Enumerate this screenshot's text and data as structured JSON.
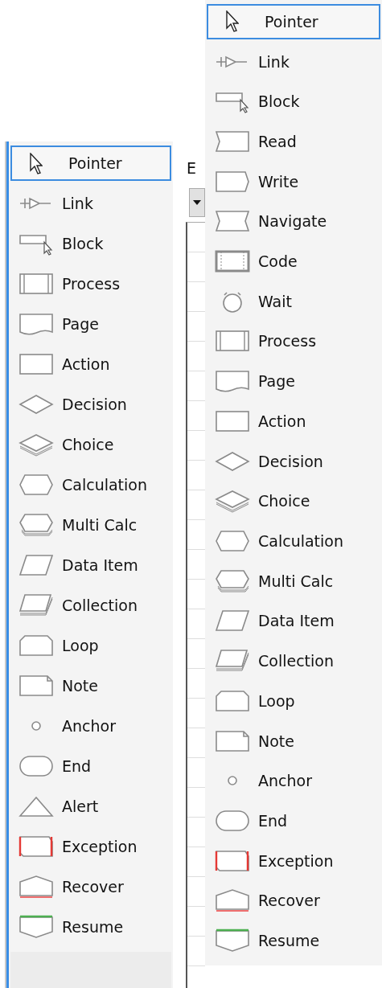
{
  "left_toolbox": {
    "items": [
      {
        "label": "Pointer",
        "kind": "pointer",
        "selected": true
      },
      {
        "label": "Link",
        "kind": "link",
        "selected": false
      },
      {
        "label": "Block",
        "kind": "block",
        "selected": false
      },
      {
        "label": "Process",
        "kind": "process",
        "selected": false
      },
      {
        "label": "Page",
        "kind": "page",
        "selected": false
      },
      {
        "label": "Action",
        "kind": "action",
        "selected": false
      },
      {
        "label": "Decision",
        "kind": "decision",
        "selected": false
      },
      {
        "label": "Choice",
        "kind": "choice",
        "selected": false
      },
      {
        "label": "Calculation",
        "kind": "calculation",
        "selected": false
      },
      {
        "label": "Multi Calc",
        "kind": "multicalc",
        "selected": false
      },
      {
        "label": "Data Item",
        "kind": "dataitem",
        "selected": false
      },
      {
        "label": "Collection",
        "kind": "collection",
        "selected": false
      },
      {
        "label": "Loop",
        "kind": "loop",
        "selected": false
      },
      {
        "label": "Note",
        "kind": "note",
        "selected": false
      },
      {
        "label": "Anchor",
        "kind": "anchor",
        "selected": false
      },
      {
        "label": "End",
        "kind": "end",
        "selected": false
      },
      {
        "label": "Alert",
        "kind": "alert",
        "selected": false
      },
      {
        "label": "Exception",
        "kind": "exception",
        "selected": false
      },
      {
        "label": "Recover",
        "kind": "recover",
        "selected": false
      },
      {
        "label": "Resume",
        "kind": "resume",
        "selected": false
      }
    ]
  },
  "middle_fragment": {
    "label": "E"
  },
  "right_toolbox": {
    "items": [
      {
        "label": "Pointer",
        "kind": "pointer",
        "selected": true
      },
      {
        "label": "Link",
        "kind": "link",
        "selected": false
      },
      {
        "label": "Block",
        "kind": "block",
        "selected": false
      },
      {
        "label": "Read",
        "kind": "read",
        "selected": false
      },
      {
        "label": "Write",
        "kind": "write",
        "selected": false
      },
      {
        "label": "Navigate",
        "kind": "navigate",
        "selected": false
      },
      {
        "label": "Code",
        "kind": "code",
        "selected": false
      },
      {
        "label": "Wait",
        "kind": "wait",
        "selected": false
      },
      {
        "label": "Process",
        "kind": "process",
        "selected": false
      },
      {
        "label": "Page",
        "kind": "page",
        "selected": false
      },
      {
        "label": "Action",
        "kind": "action",
        "selected": false
      },
      {
        "label": "Decision",
        "kind": "decision",
        "selected": false
      },
      {
        "label": "Choice",
        "kind": "choice",
        "selected": false
      },
      {
        "label": "Calculation",
        "kind": "calculation",
        "selected": false
      },
      {
        "label": "Multi Calc",
        "kind": "multicalc",
        "selected": false
      },
      {
        "label": "Data Item",
        "kind": "dataitem",
        "selected": false
      },
      {
        "label": "Collection",
        "kind": "collection",
        "selected": false
      },
      {
        "label": "Loop",
        "kind": "loop",
        "selected": false
      },
      {
        "label": "Note",
        "kind": "note",
        "selected": false
      },
      {
        "label": "Anchor",
        "kind": "anchor",
        "selected": false
      },
      {
        "label": "End",
        "kind": "end",
        "selected": false
      },
      {
        "label": "Exception",
        "kind": "exception",
        "selected": false
      },
      {
        "label": "Recover",
        "kind": "recover",
        "selected": false
      },
      {
        "label": "Resume",
        "kind": "resume",
        "selected": false
      }
    ]
  }
}
